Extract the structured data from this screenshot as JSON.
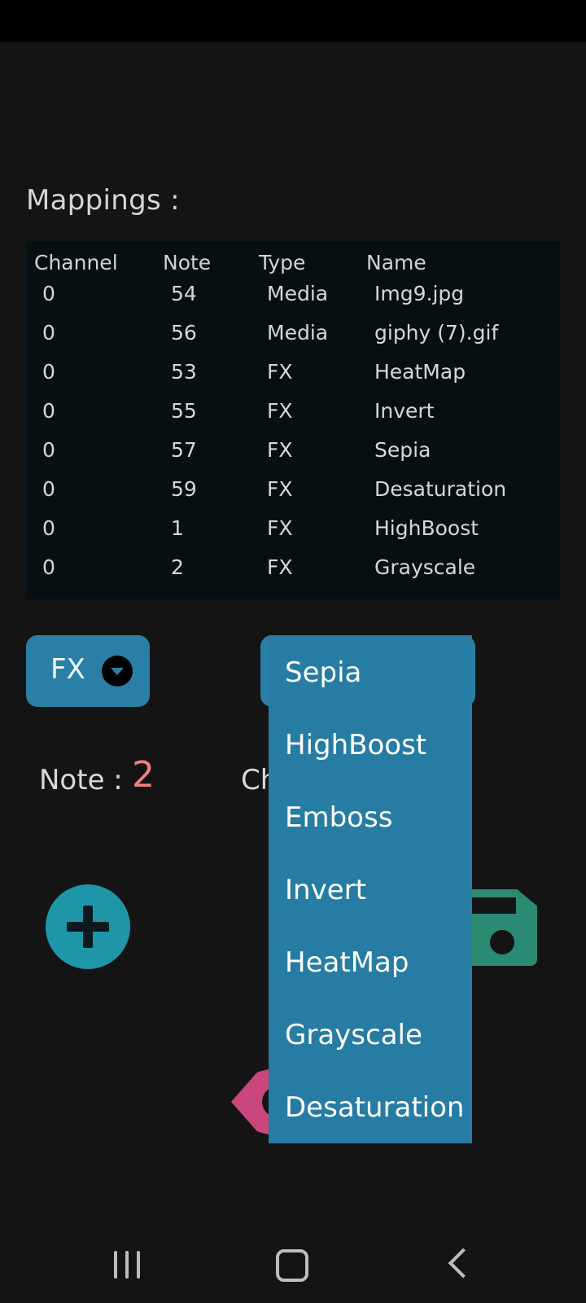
{
  "mappings": {
    "title": "Mappings :",
    "headers": [
      "Channel",
      "Note",
      "Type",
      "Name"
    ],
    "rows": [
      [
        "0",
        "54",
        "Media",
        "Img9.jpg"
      ],
      [
        "0",
        "56",
        "Media",
        "giphy (7).gif"
      ],
      [
        "0",
        "53",
        "FX",
        "HeatMap"
      ],
      [
        "0",
        "55",
        "FX",
        "Invert"
      ],
      [
        "0",
        "57",
        "FX",
        "Sepia"
      ],
      [
        "0",
        "59",
        "FX",
        "Desaturation"
      ],
      [
        "0",
        "1",
        "FX",
        "HighBoost"
      ],
      [
        "0",
        "2",
        "FX",
        "Grayscale"
      ]
    ]
  },
  "type_select": {
    "value": "FX",
    "icon": "chevron-down-circle-icon"
  },
  "effect_dropdown": {
    "options": [
      "Sepia",
      "HighBoost",
      "Emboss",
      "Invert",
      "HeatMap",
      "Grayscale",
      "Desaturation"
    ]
  },
  "note": {
    "label": "Note :",
    "value": "2"
  },
  "channel": {
    "label_partial": "Ch"
  },
  "icons": {
    "add": "plus-icon",
    "save": "save-icon",
    "preview": "eye-icon"
  },
  "colors": {
    "accent": "#2a7fa6",
    "note_value": "#f07f82",
    "add_button": "#1f96a8",
    "save_icon": "#2b8a72",
    "eye_icon": "#c9477a"
  }
}
